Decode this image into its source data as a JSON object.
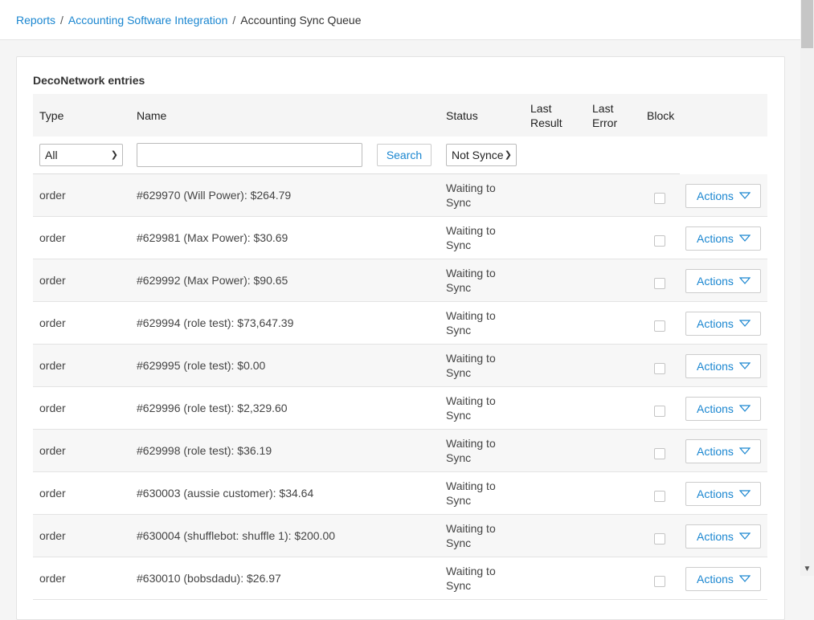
{
  "breadcrumb": {
    "items": [
      "Reports",
      "Accounting Software Integration"
    ],
    "current": "Accounting Sync Queue"
  },
  "card": {
    "title": "DecoNetwork entries"
  },
  "table": {
    "headers": {
      "type": "Type",
      "name": "Name",
      "status": "Status",
      "last_result": [
        "Last",
        "Result"
      ],
      "last_error": [
        "Last",
        "Error"
      ],
      "block": "Block"
    },
    "filters": {
      "type_value": "All",
      "name_value": "",
      "search_label": "Search",
      "status_value": "Not Synced"
    },
    "action_label": "Actions",
    "rows": [
      {
        "type": "order",
        "name": "#629970 (Will Power): $264.79",
        "status": [
          "Waiting to",
          "Sync"
        ]
      },
      {
        "type": "order",
        "name": "#629981 (Max Power): $30.69",
        "status": [
          "Waiting to",
          "Sync"
        ]
      },
      {
        "type": "order",
        "name": "#629992 (Max Power): $90.65",
        "status": [
          "Waiting to",
          "Sync"
        ]
      },
      {
        "type": "order",
        "name": "#629994 (role test): $73,647.39",
        "status": [
          "Waiting to",
          "Sync"
        ]
      },
      {
        "type": "order",
        "name": "#629995 (role test): $0.00",
        "status": [
          "Waiting to",
          "Sync"
        ]
      },
      {
        "type": "order",
        "name": "#629996 (role test): $2,329.60",
        "status": [
          "Waiting to",
          "Sync"
        ]
      },
      {
        "type": "order",
        "name": "#629998 (role test): $36.19",
        "status": [
          "Waiting to",
          "Sync"
        ]
      },
      {
        "type": "order",
        "name": "#630003 (aussie customer): $34.64",
        "status": [
          "Waiting to",
          "Sync"
        ]
      },
      {
        "type": "order",
        "name": "#630004 (shufflebot: shuffle 1): $200.00",
        "status": [
          "Waiting to",
          "Sync"
        ]
      },
      {
        "type": "order",
        "name": "#630010 (bobsdadu): $26.97",
        "status": [
          "Waiting to",
          "Sync"
        ]
      }
    ]
  },
  "colors": {
    "link": "#1a86d0",
    "row_alt": "#f7f7f7",
    "header_bg": "#f5f5f5"
  }
}
